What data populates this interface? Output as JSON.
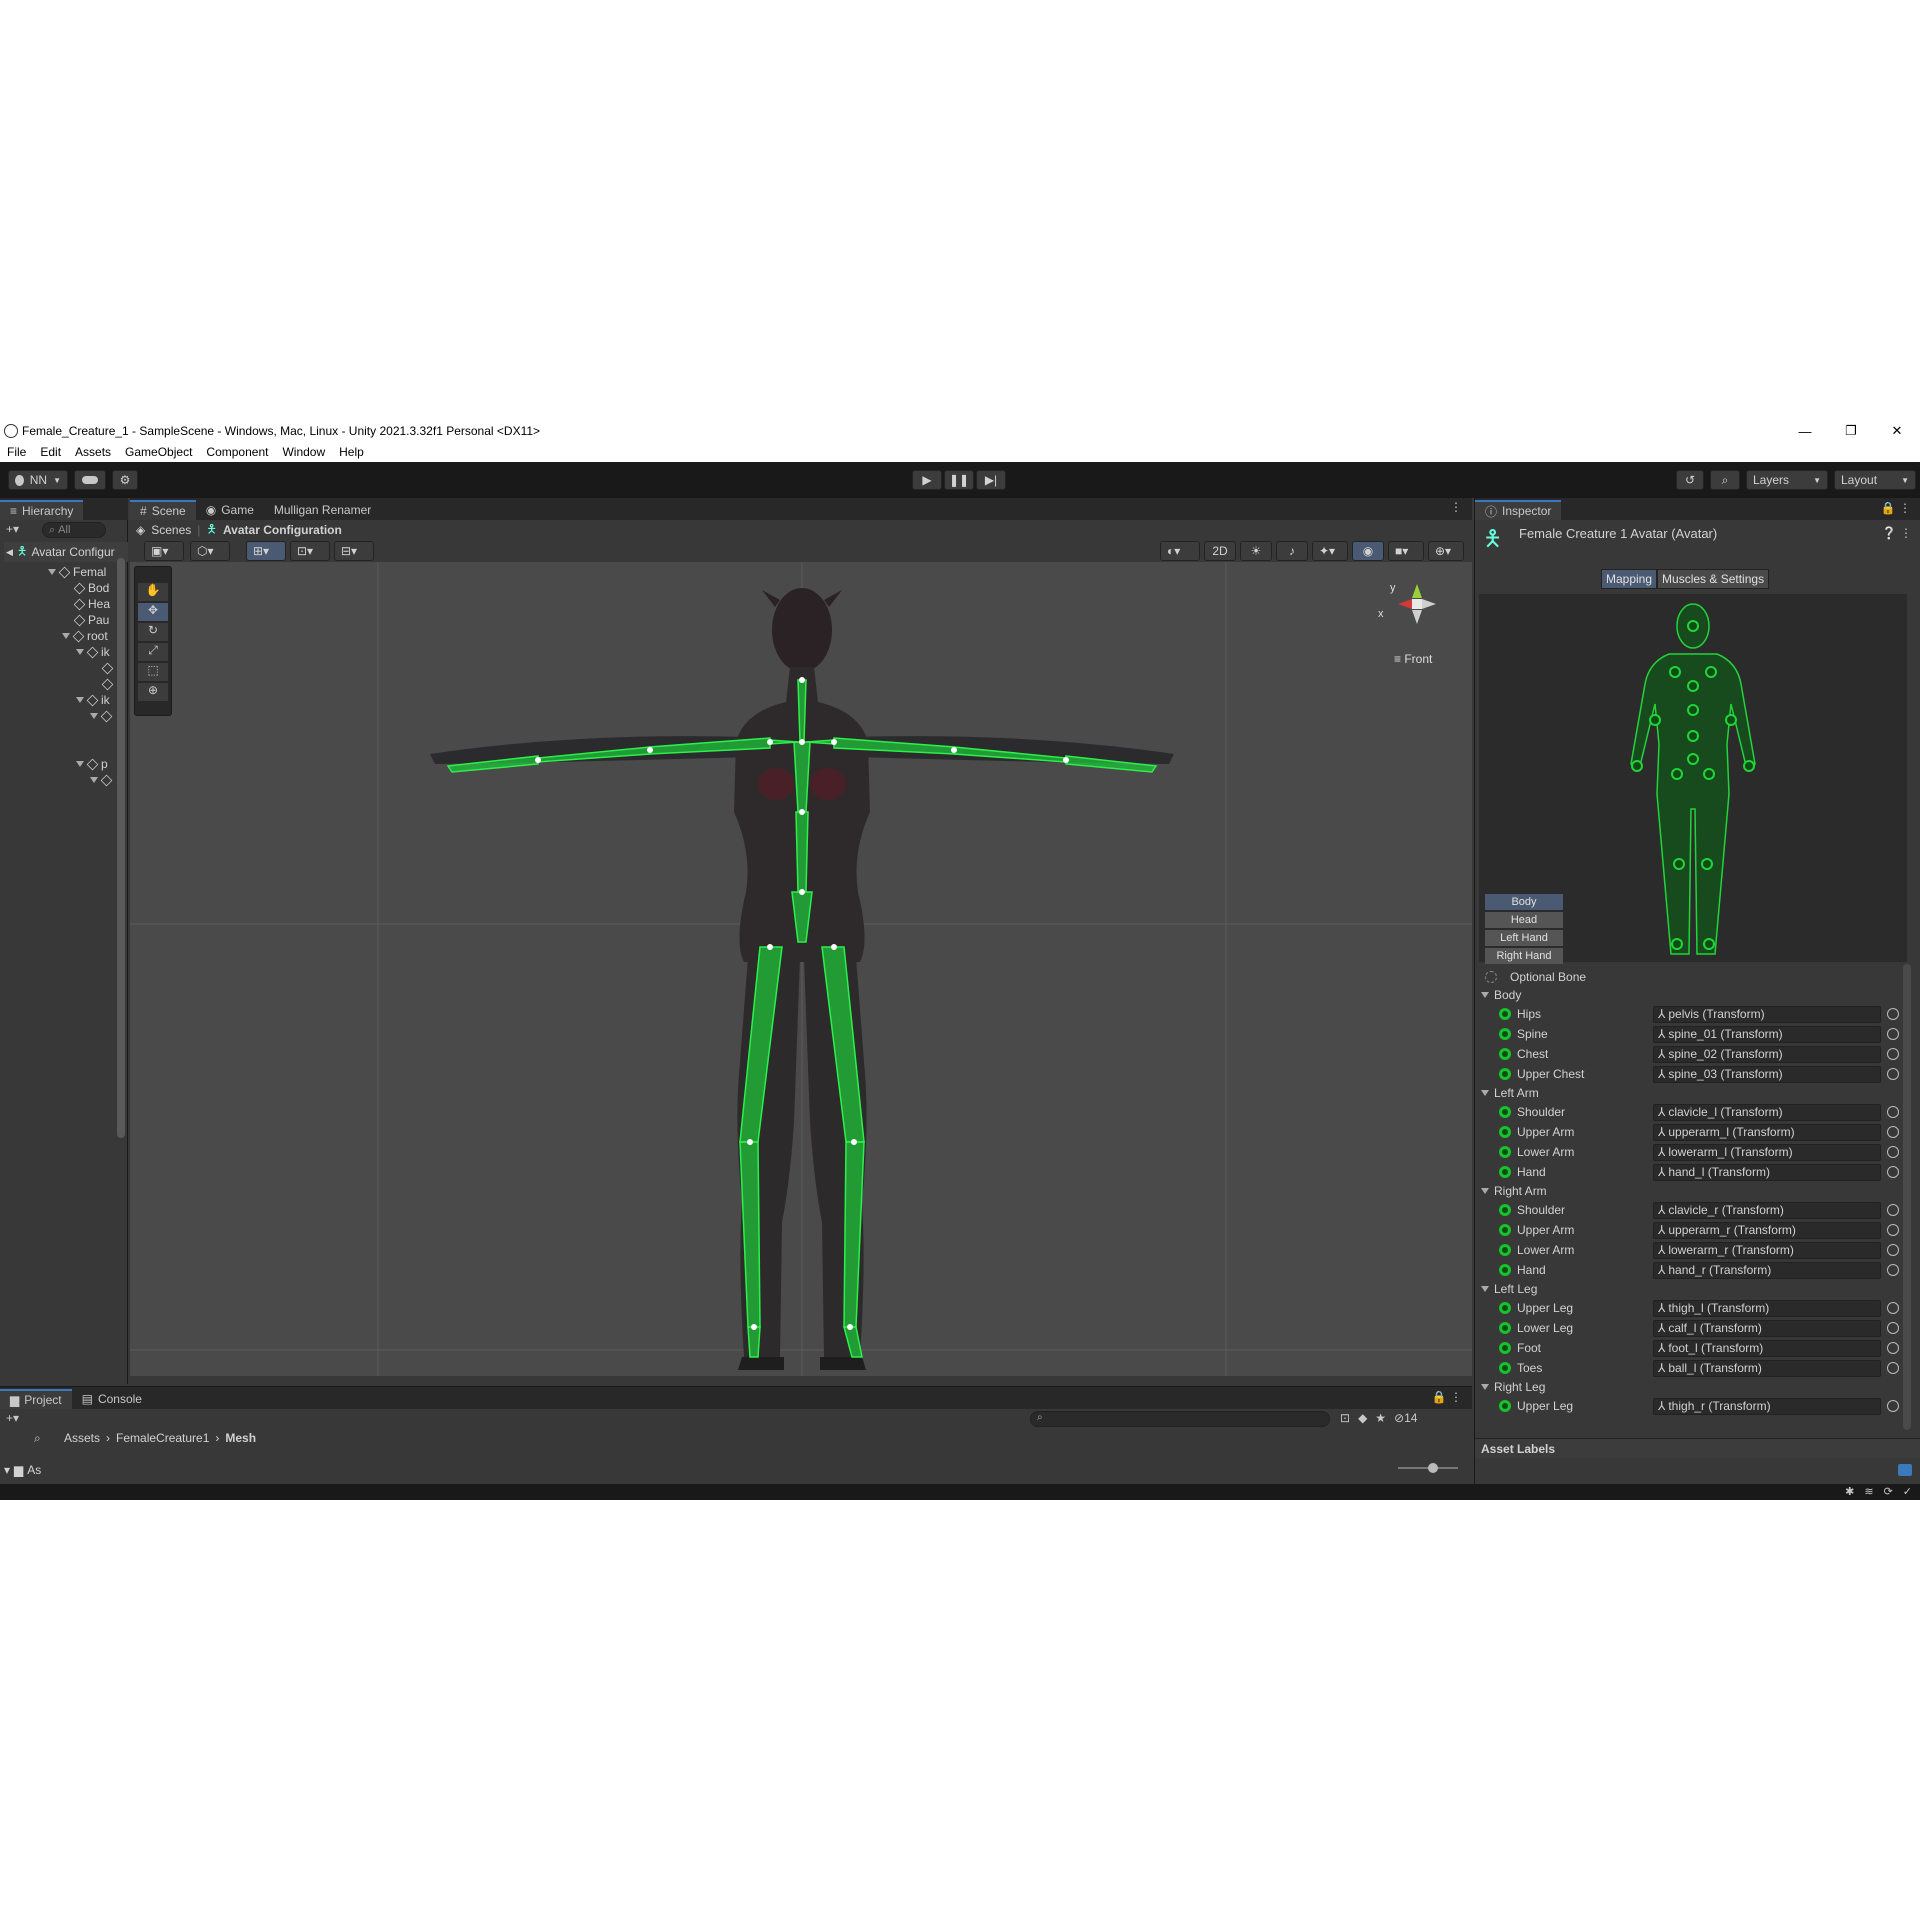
{
  "window": {
    "title": "Female_Creature_1 - SampleScene - Windows, Mac, Linux - Unity 2021.3.32f1 Personal <DX11>",
    "controls": [
      "—",
      "❐",
      "✕"
    ]
  },
  "menu": [
    "File",
    "Edit",
    "Assets",
    "GameObject",
    "Component",
    "Window",
    "Help"
  ],
  "toolbar": {
    "account": "NN",
    "layers": "Layers",
    "layout": "Layout"
  },
  "hierarchy": {
    "tab": "Hierarchy",
    "search_placeholder": "All",
    "root": "Avatar Configur",
    "items": [
      "Femal",
      "Bod",
      "Hea",
      "Pau",
      "root",
      "ik",
      "ik",
      "p"
    ]
  },
  "scene": {
    "tabs": [
      "Scene",
      "Game",
      "Mulligan Renamer"
    ],
    "breadcrumb": [
      "Scenes",
      "Avatar Configuration"
    ],
    "mode_2d": "2D",
    "gizmo_label": "Front",
    "gizmo_axes": {
      "y": "y",
      "x": "x"
    }
  },
  "inspector": {
    "tab": "Inspector",
    "title": "Female Creature 1 Avatar (Avatar)",
    "subtabs": [
      "Mapping",
      "Muscles & Settings"
    ],
    "body_buttons": [
      "Body",
      "Head",
      "Left Hand",
      "Right Hand"
    ],
    "optional_bone": "Optional Bone",
    "sections": [
      {
        "name": "Body",
        "bones": [
          {
            "label": "Hips",
            "value": "pelvis (Transform)"
          },
          {
            "label": "Spine",
            "value": "spine_01 (Transform)"
          },
          {
            "label": "Chest",
            "value": "spine_02 (Transform)"
          },
          {
            "label": "Upper Chest",
            "value": "spine_03 (Transform)"
          }
        ]
      },
      {
        "name": "Left Arm",
        "bones": [
          {
            "label": "Shoulder",
            "value": "clavicle_l (Transform)"
          },
          {
            "label": "Upper Arm",
            "value": "upperarm_l (Transform)"
          },
          {
            "label": "Lower Arm",
            "value": "lowerarm_l (Transform)"
          },
          {
            "label": "Hand",
            "value": "hand_l (Transform)"
          }
        ]
      },
      {
        "name": "Right Arm",
        "bones": [
          {
            "label": "Shoulder",
            "value": "clavicle_r (Transform)"
          },
          {
            "label": "Upper Arm",
            "value": "upperarm_r (Transform)"
          },
          {
            "label": "Lower Arm",
            "value": "lowerarm_r (Transform)"
          },
          {
            "label": "Hand",
            "value": "hand_r (Transform)"
          }
        ]
      },
      {
        "name": "Left Leg",
        "bones": [
          {
            "label": "Upper Leg",
            "value": "thigh_l (Transform)"
          },
          {
            "label": "Lower Leg",
            "value": "calf_l (Transform)"
          },
          {
            "label": "Foot",
            "value": "foot_l (Transform)"
          },
          {
            "label": "Toes",
            "value": "ball_l (Transform)"
          }
        ]
      },
      {
        "name": "Right Leg",
        "bones": [
          {
            "label": "Upper Leg",
            "value": "thigh_r (Transform)"
          }
        ]
      }
    ],
    "asset_labels": "Asset Labels"
  },
  "project": {
    "tabs": [
      "Project",
      "Console"
    ],
    "breadcrumb": [
      "Assets",
      "FemaleCreature1",
      "Mesh"
    ],
    "hidden_count": "14",
    "folder_label": "As"
  },
  "colors": {
    "accent": "#3a79bb",
    "bone_green": "#18c12e",
    "panel_bg": "#383838",
    "scene_bg": "#4a4a4a"
  }
}
